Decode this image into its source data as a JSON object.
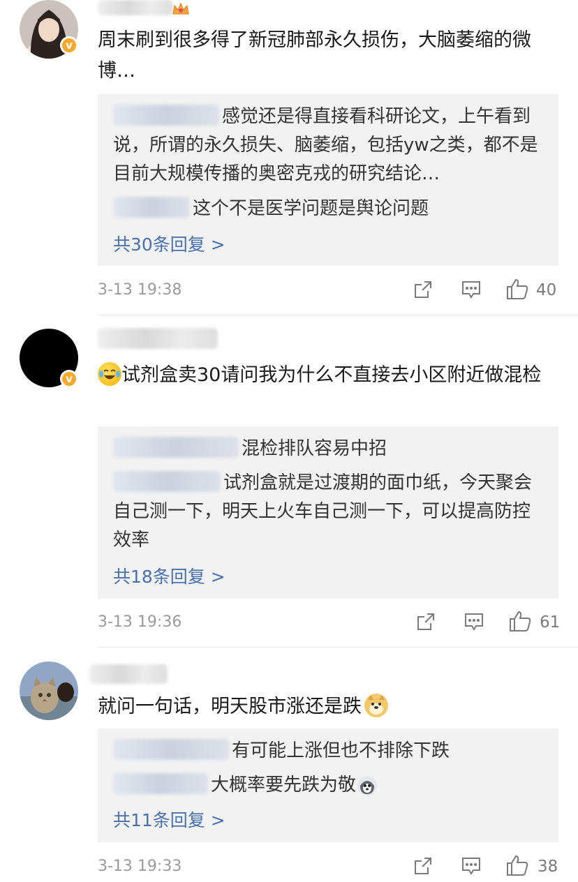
{
  "comments": [
    {
      "body": "周末刷到很多得了新冠肺部永久损伤，大脑萎缩的微博…",
      "replies": [
        {
          "text": "感觉还是得直接看科研论文，上午看到说，所谓的永久损失、脑萎缩，包括yw之类，都不是目前大规模传播的奥密克戎的研究结论…"
        },
        {
          "text": "这个不是医学问题是舆论问题"
        }
      ],
      "more_replies": "共30条回复 >",
      "time": "3-13 19:38",
      "likes": "40"
    },
    {
      "body": "试剂盒卖30请问我为什么不直接去小区附近做混检",
      "replies": [
        {
          "text": "混检排队容易中招"
        },
        {
          "text": "试剂盒就是过渡期的面巾纸，今天聚会自己测一下，明天上火车自己测一下，可以提高防控效率"
        }
      ],
      "more_replies": "共18条回复 >",
      "time": "3-13 19:36",
      "likes": "61"
    },
    {
      "body": "就问一句话，明天股市涨还是跌",
      "replies": [
        {
          "text": "有可能上涨但也不排除下跌"
        },
        {
          "text": "大概率要先跌为敬"
        }
      ],
      "more_replies": "共11条回复 >",
      "time": "3-13 19:33",
      "likes": "38"
    }
  ],
  "icons": {
    "repost": "share-icon",
    "comment": "comment-icon",
    "like": "thumbs-up-icon",
    "verified": "verified-badge-icon",
    "badge_char": "v"
  },
  "colors": {
    "link_blue": "#4a70aa",
    "verified_orange": "#f7a82e",
    "reply_bg": "#f2f2f2"
  }
}
